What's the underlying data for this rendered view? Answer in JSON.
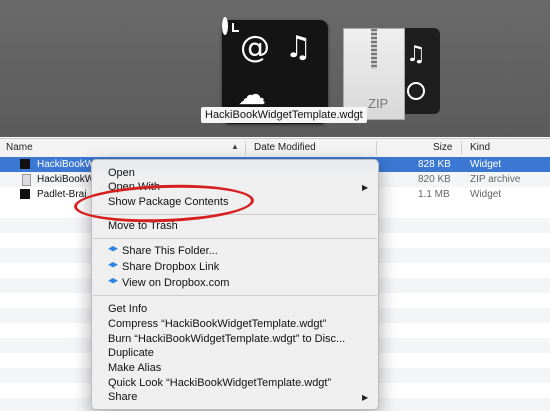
{
  "coverflow": {
    "selected_title": "HackiBookWidgetTemplate.wdgt",
    "zip_label": "ZIP",
    "icons": [
      "at-icon",
      "music-note-icon",
      "cloud-icon",
      "clock-icon"
    ]
  },
  "columns": {
    "name": "Name",
    "date": "Date Modified",
    "size": "Size",
    "kind": "Kind"
  },
  "files": [
    {
      "name": "HackiBookW",
      "size": "828 KB",
      "kind": "Widget",
      "selected": true
    },
    {
      "name": "HackiBookW",
      "size": "820 KB",
      "kind": "ZIP archive",
      "selected": false
    },
    {
      "name": "Padlet-Brai",
      "size": "1.1 MB",
      "kind": "Widget",
      "selected": false
    }
  ],
  "menu": {
    "open": "Open",
    "open_with": "Open With",
    "show_package": "Show Package Contents",
    "move_trash": "Move to Trash",
    "share_folder": "Share This Folder...",
    "share_link": "Share Dropbox Link",
    "view_dropbox": "View on Dropbox.com",
    "get_info": "Get Info",
    "compress": "Compress “HackiBookWidgetTemplate.wdgt”",
    "burn": "Burn “HackiBookWidgetTemplate.wdgt” to Disc...",
    "duplicate": "Duplicate",
    "make_alias": "Make Alias",
    "quick_look": "Quick Look “HackiBookWidgetTemplate.wdgt”",
    "share": "Share"
  },
  "colors": {
    "selection": "#3b78d4",
    "highlight_ring": "#d61f1f"
  }
}
